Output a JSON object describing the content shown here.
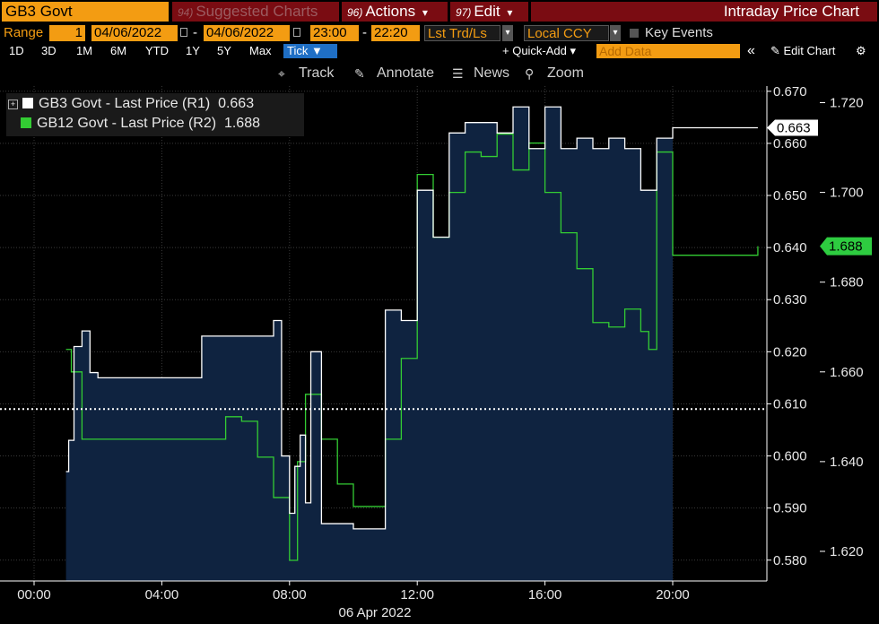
{
  "header": {
    "ticker": "GB3 Govt",
    "menus": [
      {
        "num": "94)",
        "label": "Suggested Charts",
        "dim": true
      },
      {
        "num": "96)",
        "label": "Actions",
        "caret": "▾"
      },
      {
        "num": "97)",
        "label": "Edit",
        "caret": "▾"
      }
    ],
    "title": "Intraday Price Chart"
  },
  "range_bar": {
    "range_label": "Range",
    "range_value": "1",
    "start_date": "04/06/2022",
    "dash": "-",
    "end_date": "04/06/2022",
    "start_time": "23:00",
    "end_time": "22:20",
    "price_type": "Lst Trd/Ls",
    "currency": "Local CCY",
    "key_events": "Key Events"
  },
  "period_bar": {
    "periods": [
      "1D",
      "3D",
      "1M",
      "6M",
      "YTD",
      "1Y",
      "5Y",
      "Max"
    ],
    "selected": "Tick ▼",
    "quick_add": "+ Quick-Add ▾",
    "add_data_placeholder": "Add Data",
    "collapse": "«",
    "edit_chart": "✎ Edit Chart",
    "gear": "⚙"
  },
  "toolbar": {
    "track": "Track",
    "annotate": "Annotate",
    "news": "News",
    "zoom": "Zoom"
  },
  "colors": {
    "series1": "#ffffff",
    "series2": "#33cc33",
    "area_fill": "#0f2340",
    "last1_bg": "#ffffff",
    "last2_bg": "#2ecc40"
  },
  "chart_data": {
    "type": "line",
    "x_date": "06 Apr 2022",
    "x_ticks": [
      "00:00",
      "04:00",
      "08:00",
      "12:00",
      "16:00",
      "20:00"
    ],
    "xlim": [
      "00:00",
      "23:00"
    ],
    "grid": true,
    "legend_position": "top-left",
    "ref_line": 0.609,
    "axes": {
      "R1": {
        "ylim": [
          0.576,
          0.671
        ],
        "ticks": [
          "0.670",
          "0.660",
          "0.650",
          "0.640",
          "0.630",
          "0.620",
          "0.610",
          "0.600",
          "0.590",
          "0.580"
        ]
      },
      "R2": {
        "ylim": [
          1.6134,
          1.7237
        ],
        "ticks": [
          "1.720",
          "1.700",
          "1.680",
          "1.660",
          "1.640",
          "1.620"
        ]
      }
    },
    "series": [
      {
        "name": "GB3 Govt - Last Price (R1)",
        "axis": "R1",
        "last": "0.663",
        "x": [
          "01:00",
          "01:05",
          "01:15",
          "01:30",
          "01:45",
          "02:00",
          "03:00",
          "04:00",
          "05:00",
          "05:15",
          "06:00",
          "07:00",
          "07:30",
          "07:45",
          "08:00",
          "08:10",
          "08:20",
          "08:30",
          "08:40",
          "09:00",
          "10:00",
          "10:30",
          "11:00",
          "11:30",
          "12:00",
          "12:30",
          "13:00",
          "13:30",
          "14:00",
          "14:30",
          "15:00",
          "15:30",
          "16:00",
          "16:30",
          "17:00",
          "17:30",
          "18:00",
          "18:30",
          "19:00",
          "19:30",
          "20:00",
          "22:40"
        ],
        "y": [
          0.597,
          0.603,
          0.621,
          0.624,
          0.616,
          0.615,
          0.615,
          0.615,
          0.615,
          0.623,
          0.623,
          0.623,
          0.626,
          0.6,
          0.589,
          0.598,
          0.604,
          0.591,
          0.62,
          0.587,
          0.586,
          0.586,
          0.628,
          0.626,
          0.651,
          0.642,
          0.662,
          0.664,
          0.664,
          0.662,
          0.667,
          0.659,
          0.667,
          0.659,
          0.661,
          0.659,
          0.661,
          0.659,
          0.651,
          0.661,
          0.663,
          0.663
        ]
      },
      {
        "name": "GB12 Govt - Last Price (R2)",
        "axis": "R2",
        "last": "1.688",
        "x": [
          "01:00",
          "01:10",
          "01:30",
          "01:45",
          "02:00",
          "03:00",
          "04:00",
          "05:00",
          "06:00",
          "06:30",
          "07:00",
          "07:30",
          "08:00",
          "08:15",
          "08:30",
          "09:00",
          "09:30",
          "10:00",
          "10:30",
          "11:00",
          "11:30",
          "12:00",
          "12:30",
          "13:00",
          "13:30",
          "14:00",
          "14:30",
          "15:00",
          "15:30",
          "16:00",
          "16:30",
          "17:00",
          "17:30",
          "18:00",
          "18:30",
          "19:00",
          "19:15",
          "19:30",
          "20:00",
          "22:40"
        ],
        "y": [
          1.665,
          1.66,
          1.645,
          1.645,
          1.645,
          1.645,
          1.645,
          1.645,
          1.65,
          1.649,
          1.641,
          1.632,
          1.618,
          1.64,
          1.655,
          1.645,
          1.635,
          1.63,
          1.63,
          1.645,
          1.663,
          1.704,
          1.69,
          1.7,
          1.709,
          1.708,
          1.713,
          1.705,
          1.711,
          1.7,
          1.691,
          1.683,
          1.671,
          1.67,
          1.674,
          1.669,
          1.665,
          1.709,
          1.686,
          1.688
        ]
      }
    ]
  }
}
